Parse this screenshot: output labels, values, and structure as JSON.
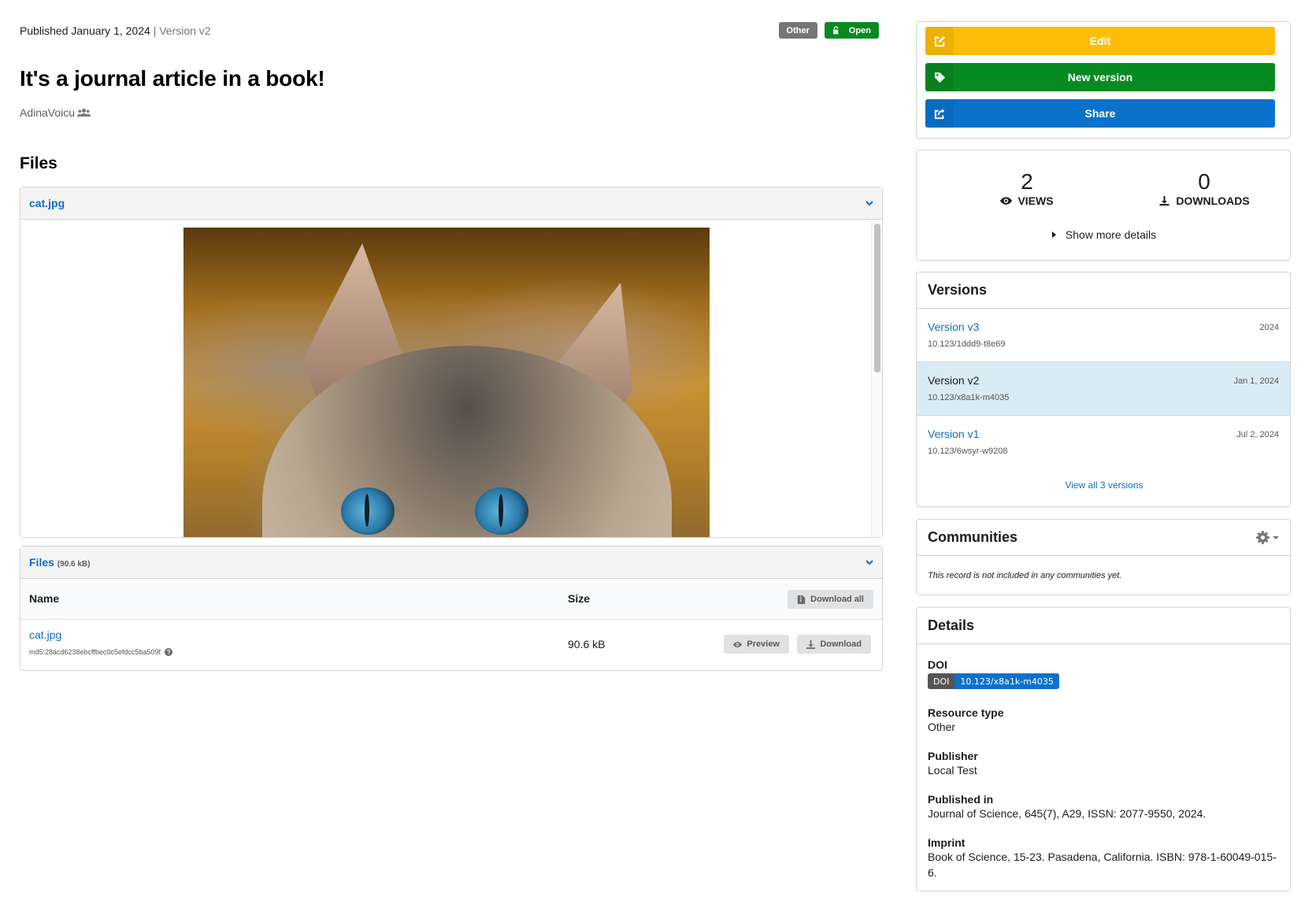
{
  "header": {
    "published_label": "Published January 1, 2024",
    "separator": "|",
    "version_label": "Version v2",
    "badges": [
      {
        "label": "Other",
        "color": "#767676"
      },
      {
        "label": "Open",
        "color": "#088a22",
        "icon": "unlock-icon"
      }
    ],
    "title": "It's a journal article in a book!",
    "creator": "AdinaVoicu",
    "creator_icon": "users-icon"
  },
  "files_section": {
    "heading": "Files",
    "preview": {
      "file_name": "cat.jpg",
      "image_alt": "Cat with blue eyes"
    },
    "files_panel": {
      "title": "Files",
      "total_size": "(90.6 kB)",
      "columns": [
        "Name",
        "Size"
      ],
      "download_all_label": "Download all",
      "rows": [
        {
          "name": "cat.jpg",
          "checksum": "md5:28acd6238ebcffbec0c5efdcc5ba509f",
          "size": "90.6 kB",
          "preview_label": "Preview",
          "download_label": "Download"
        }
      ]
    }
  },
  "sidebar": {
    "actions": {
      "edit_label": "Edit",
      "new_version_label": "New version",
      "share_label": "Share",
      "colors": {
        "edit": "#fbbd08",
        "new_version": "#088a22",
        "share": "#0a72cc"
      }
    },
    "stats": {
      "views_count": "2",
      "views_label": "VIEWS",
      "downloads_count": "0",
      "downloads_label": "DOWNLOADS",
      "more_details_label": "Show more details"
    },
    "versions": {
      "heading": "Versions",
      "items": [
        {
          "name": "Version v3",
          "doi": "10.123/1ddd9-t8e69",
          "date": "2024",
          "active": false
        },
        {
          "name": "Version v2",
          "doi": "10.123/x8a1k-m4035",
          "date": "Jan 1, 2024",
          "active": true
        },
        {
          "name": "Version v1",
          "doi": "10.123/6wsyr-w9208",
          "date": "Jul 2, 2024",
          "active": false
        }
      ],
      "view_all_label": "View all 3 versions"
    },
    "communities": {
      "heading": "Communities",
      "empty_text": "This record is not included in any communities yet."
    },
    "details": {
      "heading": "Details",
      "doi_label": "DOI",
      "doi_badge_key": "DOI",
      "doi_value": "10.123/x8a1k-m4035",
      "resource_type_label": "Resource type",
      "resource_type": "Other",
      "publisher_label": "Publisher",
      "publisher": "Local Test",
      "published_in_label": "Published in",
      "published_in": "Journal of Science, 645(7), A29, ISSN: 2077-9550, 2024.",
      "imprint_label": "Imprint",
      "imprint": "Book of Science, 15-23. Pasadena, California. ISBN: 978-1-60049-015-6."
    }
  }
}
